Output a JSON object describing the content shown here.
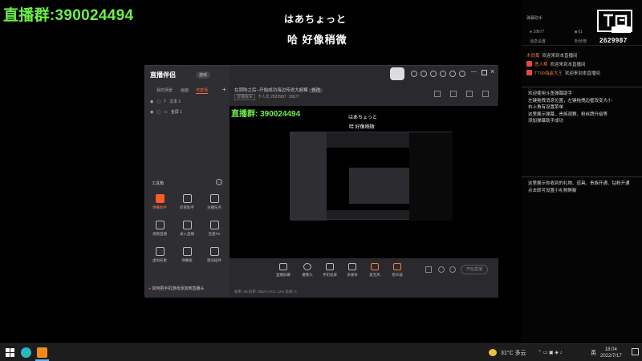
{
  "overlay": {
    "group_label": "直播群:",
    "group_number": "390024494",
    "subtitle_1": "はあちょっと",
    "subtitle_2": "哈 好像稍微"
  },
  "right_panel": {
    "title": "弹幕助手",
    "room_id": "2629987",
    "stats": [
      "18677",
      "61"
    ],
    "tabs": [
      "消息设置",
      "粉丝榜"
    ],
    "chat": [
      {
        "name": "木同蕉",
        "text": "欢迎来到本直播间"
      },
      {
        "name": "恶人帮",
        "text": "欢迎来到本直播间"
      },
      {
        "name": "TT99海盗大王",
        "text": "欢迎来到本直播间"
      }
    ],
    "help_lines": [
      "欢迎使用斗鱼弹幕助手",
      "左键拖拽消息位置，左键拖拽边框改变大小",
      "右上角有设置菜单",
      "这里展示弹幕、贵族观赛、粉丝牌升级等",
      "添加弹幕助手成功"
    ],
    "gift_lines": [
      "这里展示你收到的礼物、道具、贵族开通、钻粉开通",
      "点击即可设置小礼物屏蔽"
    ]
  },
  "app": {
    "logo": "直播伴侣",
    "badge": "游戏",
    "sidebar_tabs": [
      "我的场景",
      "画面",
      "可变场"
    ],
    "scenes": [
      "文本 1",
      "金屏 1"
    ],
    "tools_title": "工具箱",
    "tools": [
      {
        "label": "弹幕助手",
        "highlight": true
      },
      {
        "label": "房管助手",
        "highlight": false
      },
      {
        "label": "主播任务",
        "highlight": false
      },
      {
        "label": "视频直播",
        "highlight": false
      },
      {
        "label": "录入直播",
        "highlight": false
      },
      {
        "label": "连麦PK",
        "highlight": false
      },
      {
        "label": "虚拟形象",
        "highlight": false
      },
      {
        "label": "弹幕板",
        "highlight": false
      },
      {
        "label": "歌词插件",
        "highlight": false
      }
    ],
    "hint": "如何把手机游戏添加到直播头",
    "stream_title": "在阴陆之后--开始成功海边传说大超模",
    "stream_tag": "修改",
    "stream_meta": [
      "雷霆版军",
      "下人次 2629987",
      "18677"
    ],
    "preview": {
      "group": "直播群:  390024494",
      "sub1": "はあちょっと",
      "sub2": "哈 好像稍微"
    },
    "controls": [
      "直播屏幕",
      "摄像头",
      "手机投屏",
      "多媒体",
      "麦克风",
      "扬声器"
    ],
    "start_label": "开始直播",
    "status": "帧率: 60  码率: 0kb/s  CPU: 12%  丢帧: 0"
  },
  "taskbar": {
    "weather": "31°C 多云",
    "lang": "英",
    "time": "18:04",
    "date": "2022/7/17"
  }
}
